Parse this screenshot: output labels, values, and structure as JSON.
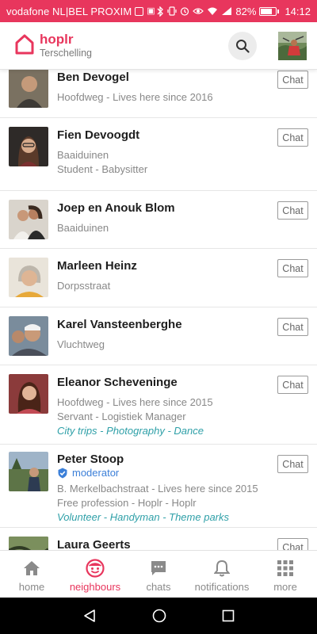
{
  "status_bar": {
    "carrier": "vodafone NL|BEL PROXIM",
    "battery": "82%",
    "battery_level": 0.82,
    "time": "14:12"
  },
  "header": {
    "brand": "hoplr",
    "subtitle": "Terschelling",
    "brand_color": "#e8365d"
  },
  "neighbours": [
    {
      "name": "Ben Devogel",
      "lines": [
        "Hoofdweg - Lives here since 2016"
      ],
      "chat": "Chat"
    },
    {
      "name": "Fien Devoogdt",
      "lines": [
        "Baaiduinen",
        "Student - Babysitter"
      ],
      "chat": "Chat"
    },
    {
      "name": "Joep en Anouk Blom",
      "lines": [
        "Baaiduinen"
      ],
      "chat": "Chat"
    },
    {
      "name": "Marleen Heinz",
      "lines": [
        "Dorpsstraat"
      ],
      "chat": "Chat"
    },
    {
      "name": "Karel Vansteenberghe",
      "lines": [
        "Vluchtweg"
      ],
      "chat": "Chat"
    },
    {
      "name": "Eleanor Scheveninge",
      "lines": [
        "Hoofdweg - Lives here since 2015",
        "Servant - Logistiek Manager"
      ],
      "tags": "City trips - Photography - Dance",
      "chat": "Chat"
    },
    {
      "name": "Peter Stoop",
      "badge": "moderator",
      "lines": [
        "B. Merkelbachstraat - Lives here since 2015",
        "Free profession - Hoplr - Hoplr"
      ],
      "tags": "Volunteer - Handyman - Theme parks",
      "chat": "Chat"
    },
    {
      "name": "Laura Geerts",
      "lines": [],
      "chat": "Chat"
    }
  ],
  "bottom_nav": {
    "home": "home",
    "neighbours": "neighbours",
    "chats": "chats",
    "notifications": "notifications",
    "more": "more",
    "active": "neighbours"
  },
  "colors": {
    "accent": "#e8365d",
    "tag_color": "#2fa0a8",
    "moderator_color": "#3b7fd8"
  }
}
